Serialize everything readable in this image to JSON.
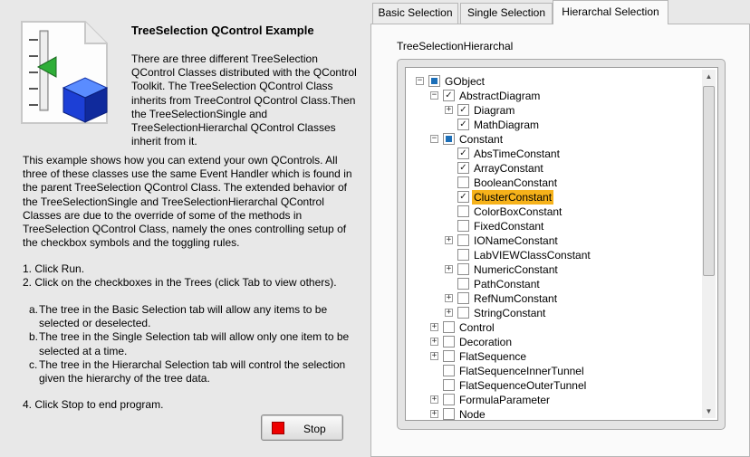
{
  "description": {
    "title": "TreeSelection QControl Example",
    "intro": "There are three different TreeSelection QControl Classes distributed with the QControl Toolkit.  The TreeSelection QControl Class inherits from TreeControl QControl Class.Then the TreeSelectionSingle and TreeSelectionHierarchal QControl Classes inherit from it.",
    "paragraph2": "This example shows how you can extend your own QControls.  All three of these classes use the same Event Handler which is found in the parent TreeSelection QControl Class.  The extended behavior of the TreeSelectionSingle and TreeSelectionHierarchal QControl Classes are due to the override of some of the methods in TreeSelection QControl Class, namely the ones controlling setup of the checkbox symbols and the toggling rules.",
    "step1": "1. Click Run.",
    "step2": "2. Click on the checkboxes in the Trees (click Tab to view others).",
    "sub_a_label": "a.",
    "sub_a": "The tree in the Basic Selection tab will allow any items to be selected or deselected.",
    "sub_b_label": "b.",
    "sub_b": "The tree in the Single Selection tab will allow only one item to be selected at a time.",
    "sub_c_label": "c.",
    "sub_c": "The tree in the Hierarchal Selection tab will control the selection given the hierarchy of the tree data.",
    "step4": "4. Click Stop to end program."
  },
  "stop_button": {
    "label": "Stop",
    "color": "#ee0000"
  },
  "tabs": [
    {
      "label": "Basic Selection"
    },
    {
      "label": "Single Selection"
    },
    {
      "label": "Hierarchal Selection"
    }
  ],
  "tree": {
    "label": "TreeSelectionHierarchal",
    "selected_color": "#f6b21a",
    "nodes": [
      {
        "label": "GObject",
        "indent": 0,
        "expander": "minus",
        "check": "partial"
      },
      {
        "label": "AbstractDiagram",
        "indent": 1,
        "expander": "minus",
        "check": "checked"
      },
      {
        "label": "Diagram",
        "indent": 2,
        "expander": "plus",
        "check": "checked"
      },
      {
        "label": "MathDiagram",
        "indent": 2,
        "expander": "none",
        "check": "checked"
      },
      {
        "label": "Constant",
        "indent": 1,
        "expander": "minus",
        "check": "partial"
      },
      {
        "label": "AbsTimeConstant",
        "indent": 2,
        "expander": "none",
        "check": "checked"
      },
      {
        "label": "ArrayConstant",
        "indent": 2,
        "expander": "none",
        "check": "checked"
      },
      {
        "label": "BooleanConstant",
        "indent": 2,
        "expander": "none",
        "check": "unchecked"
      },
      {
        "label": "ClusterConstant",
        "indent": 2,
        "expander": "none",
        "check": "checked",
        "selected": true
      },
      {
        "label": "ColorBoxConstant",
        "indent": 2,
        "expander": "none",
        "check": "unchecked"
      },
      {
        "label": "FixedConstant",
        "indent": 2,
        "expander": "none",
        "check": "unchecked"
      },
      {
        "label": "IONameConstant",
        "indent": 2,
        "expander": "plus",
        "check": "unchecked"
      },
      {
        "label": "LabVIEWClassConstant",
        "indent": 2,
        "expander": "none",
        "check": "unchecked"
      },
      {
        "label": "NumericConstant",
        "indent": 2,
        "expander": "plus",
        "check": "unchecked"
      },
      {
        "label": "PathConstant",
        "indent": 2,
        "expander": "none",
        "check": "unchecked"
      },
      {
        "label": "RefNumConstant",
        "indent": 2,
        "expander": "plus",
        "check": "unchecked"
      },
      {
        "label": "StringConstant",
        "indent": 2,
        "expander": "plus",
        "check": "unchecked"
      },
      {
        "label": "Control",
        "indent": 1,
        "expander": "plus",
        "check": "unchecked"
      },
      {
        "label": "Decoration",
        "indent": 1,
        "expander": "plus",
        "check": "unchecked"
      },
      {
        "label": "FlatSequence",
        "indent": 1,
        "expander": "plus",
        "check": "unchecked"
      },
      {
        "label": "FlatSequenceInnerTunnel",
        "indent": 1,
        "expander": "none",
        "check": "unchecked"
      },
      {
        "label": "FlatSequenceOuterTunnel",
        "indent": 1,
        "expander": "none",
        "check": "unchecked"
      },
      {
        "label": "FormulaParameter",
        "indent": 1,
        "expander": "plus",
        "check": "unchecked"
      },
      {
        "label": "Node",
        "indent": 1,
        "expander": "plus",
        "check": "unchecked"
      }
    ]
  }
}
